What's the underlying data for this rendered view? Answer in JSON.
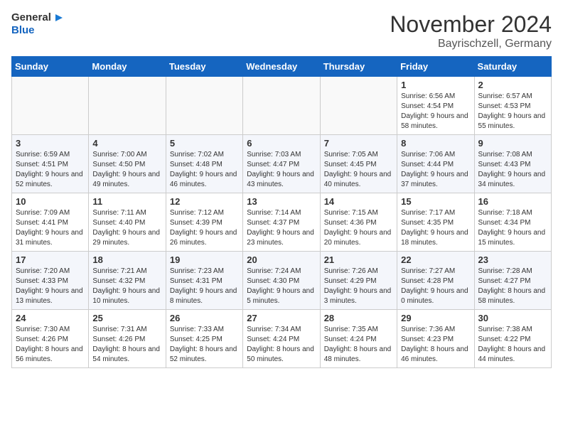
{
  "header": {
    "logo_line1": "General",
    "logo_line2": "Blue",
    "month": "November 2024",
    "location": "Bayrischzell, Germany"
  },
  "weekdays": [
    "Sunday",
    "Monday",
    "Tuesday",
    "Wednesday",
    "Thursday",
    "Friday",
    "Saturday"
  ],
  "weeks": [
    [
      {
        "day": "",
        "info": ""
      },
      {
        "day": "",
        "info": ""
      },
      {
        "day": "",
        "info": ""
      },
      {
        "day": "",
        "info": ""
      },
      {
        "day": "",
        "info": ""
      },
      {
        "day": "1",
        "info": "Sunrise: 6:56 AM\nSunset: 4:54 PM\nDaylight: 9 hours and 58 minutes."
      },
      {
        "day": "2",
        "info": "Sunrise: 6:57 AM\nSunset: 4:53 PM\nDaylight: 9 hours and 55 minutes."
      }
    ],
    [
      {
        "day": "3",
        "info": "Sunrise: 6:59 AM\nSunset: 4:51 PM\nDaylight: 9 hours and 52 minutes."
      },
      {
        "day": "4",
        "info": "Sunrise: 7:00 AM\nSunset: 4:50 PM\nDaylight: 9 hours and 49 minutes."
      },
      {
        "day": "5",
        "info": "Sunrise: 7:02 AM\nSunset: 4:48 PM\nDaylight: 9 hours and 46 minutes."
      },
      {
        "day": "6",
        "info": "Sunrise: 7:03 AM\nSunset: 4:47 PM\nDaylight: 9 hours and 43 minutes."
      },
      {
        "day": "7",
        "info": "Sunrise: 7:05 AM\nSunset: 4:45 PM\nDaylight: 9 hours and 40 minutes."
      },
      {
        "day": "8",
        "info": "Sunrise: 7:06 AM\nSunset: 4:44 PM\nDaylight: 9 hours and 37 minutes."
      },
      {
        "day": "9",
        "info": "Sunrise: 7:08 AM\nSunset: 4:43 PM\nDaylight: 9 hours and 34 minutes."
      }
    ],
    [
      {
        "day": "10",
        "info": "Sunrise: 7:09 AM\nSunset: 4:41 PM\nDaylight: 9 hours and 31 minutes."
      },
      {
        "day": "11",
        "info": "Sunrise: 7:11 AM\nSunset: 4:40 PM\nDaylight: 9 hours and 29 minutes."
      },
      {
        "day": "12",
        "info": "Sunrise: 7:12 AM\nSunset: 4:39 PM\nDaylight: 9 hours and 26 minutes."
      },
      {
        "day": "13",
        "info": "Sunrise: 7:14 AM\nSunset: 4:37 PM\nDaylight: 9 hours and 23 minutes."
      },
      {
        "day": "14",
        "info": "Sunrise: 7:15 AM\nSunset: 4:36 PM\nDaylight: 9 hours and 20 minutes."
      },
      {
        "day": "15",
        "info": "Sunrise: 7:17 AM\nSunset: 4:35 PM\nDaylight: 9 hours and 18 minutes."
      },
      {
        "day": "16",
        "info": "Sunrise: 7:18 AM\nSunset: 4:34 PM\nDaylight: 9 hours and 15 minutes."
      }
    ],
    [
      {
        "day": "17",
        "info": "Sunrise: 7:20 AM\nSunset: 4:33 PM\nDaylight: 9 hours and 13 minutes."
      },
      {
        "day": "18",
        "info": "Sunrise: 7:21 AM\nSunset: 4:32 PM\nDaylight: 9 hours and 10 minutes."
      },
      {
        "day": "19",
        "info": "Sunrise: 7:23 AM\nSunset: 4:31 PM\nDaylight: 9 hours and 8 minutes."
      },
      {
        "day": "20",
        "info": "Sunrise: 7:24 AM\nSunset: 4:30 PM\nDaylight: 9 hours and 5 minutes."
      },
      {
        "day": "21",
        "info": "Sunrise: 7:26 AM\nSunset: 4:29 PM\nDaylight: 9 hours and 3 minutes."
      },
      {
        "day": "22",
        "info": "Sunrise: 7:27 AM\nSunset: 4:28 PM\nDaylight: 9 hours and 0 minutes."
      },
      {
        "day": "23",
        "info": "Sunrise: 7:28 AM\nSunset: 4:27 PM\nDaylight: 8 hours and 58 minutes."
      }
    ],
    [
      {
        "day": "24",
        "info": "Sunrise: 7:30 AM\nSunset: 4:26 PM\nDaylight: 8 hours and 56 minutes."
      },
      {
        "day": "25",
        "info": "Sunrise: 7:31 AM\nSunset: 4:26 PM\nDaylight: 8 hours and 54 minutes."
      },
      {
        "day": "26",
        "info": "Sunrise: 7:33 AM\nSunset: 4:25 PM\nDaylight: 8 hours and 52 minutes."
      },
      {
        "day": "27",
        "info": "Sunrise: 7:34 AM\nSunset: 4:24 PM\nDaylight: 8 hours and 50 minutes."
      },
      {
        "day": "28",
        "info": "Sunrise: 7:35 AM\nSunset: 4:24 PM\nDaylight: 8 hours and 48 minutes."
      },
      {
        "day": "29",
        "info": "Sunrise: 7:36 AM\nSunset: 4:23 PM\nDaylight: 8 hours and 46 minutes."
      },
      {
        "day": "30",
        "info": "Sunrise: 7:38 AM\nSunset: 4:22 PM\nDaylight: 8 hours and 44 minutes."
      }
    ]
  ]
}
